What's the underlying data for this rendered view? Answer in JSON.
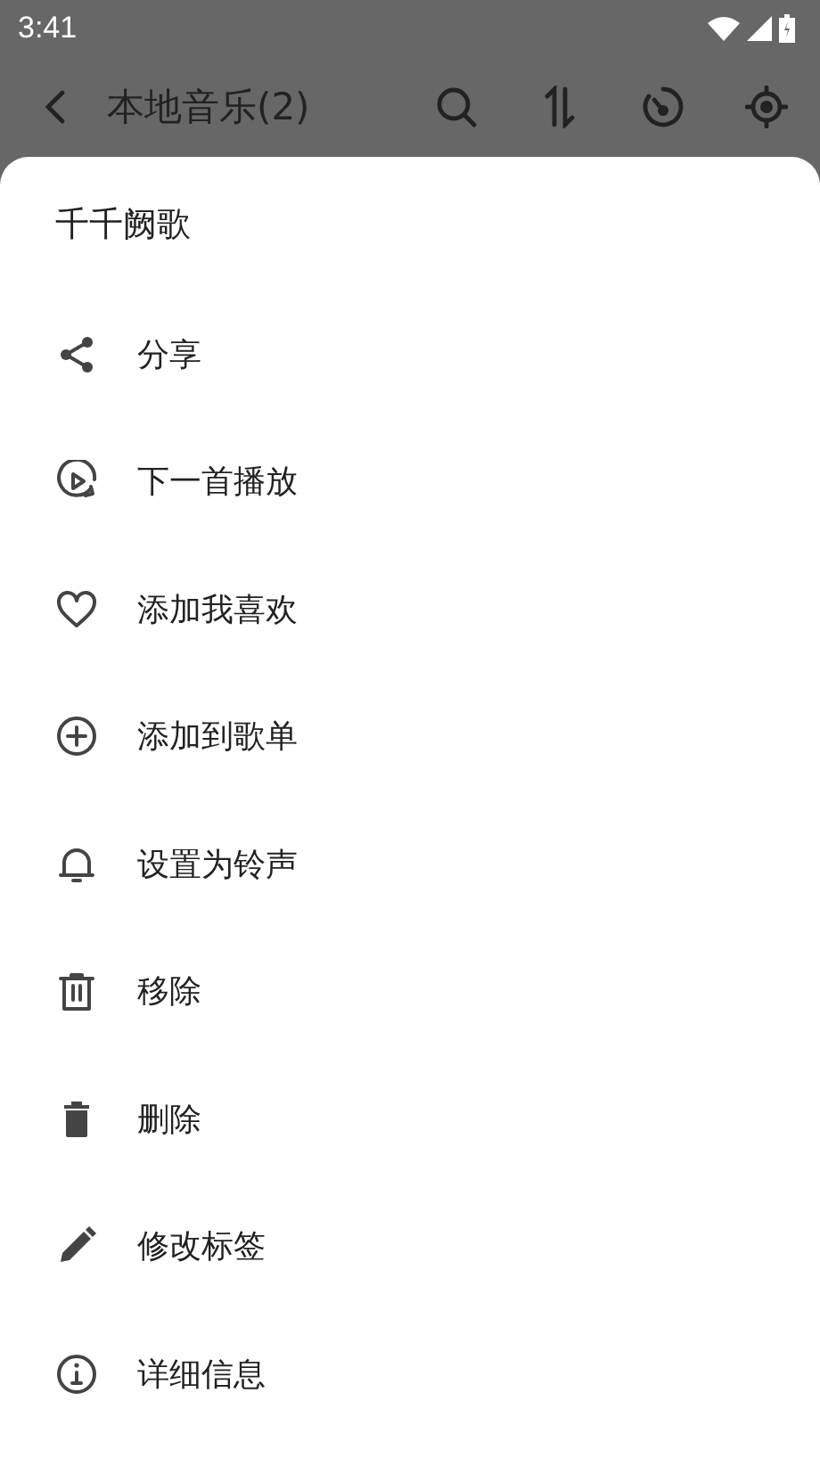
{
  "status_bar": {
    "time": "3:41"
  },
  "app_bar": {
    "title": "本地音乐(2)"
  },
  "sheet": {
    "title": "千千阙歌",
    "items": [
      {
        "label": "分享"
      },
      {
        "label": "下一首播放"
      },
      {
        "label": "添加我喜欢"
      },
      {
        "label": "添加到歌单"
      },
      {
        "label": "设置为铃声"
      },
      {
        "label": "移除"
      },
      {
        "label": "删除"
      },
      {
        "label": "修改标签"
      },
      {
        "label": "详细信息"
      }
    ]
  }
}
